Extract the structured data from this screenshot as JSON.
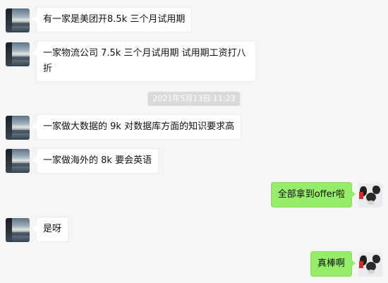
{
  "chat": {
    "messages": [
      {
        "side": "left",
        "text": "有一家是美团开8.5k 三个月试用期"
      },
      {
        "side": "left",
        "text": "一家物流公司 7.5k 三个月试用期 试用期工资打八折"
      },
      {
        "side": "left",
        "text": "一家做大数据的 9k 对数据库方面的知识要求高"
      },
      {
        "side": "left",
        "text": "一家做海外的 8k 要会英语"
      },
      {
        "side": "right",
        "text": "全部拿到offer啦"
      },
      {
        "side": "left",
        "text": "是呀"
      },
      {
        "side": "right",
        "text": "真棒啊"
      }
    ],
    "timestamp": "2021年5月13日 11:23"
  },
  "colors": {
    "background": "#f5f5f5",
    "incoming_bubble": "#ffffff",
    "outgoing_bubble": "#95ec69",
    "timestamp_bg": "#dadada"
  },
  "icons": {
    "contact_avatar": "landscape-photo-avatar",
    "self_avatar": "cow-avatar"
  }
}
